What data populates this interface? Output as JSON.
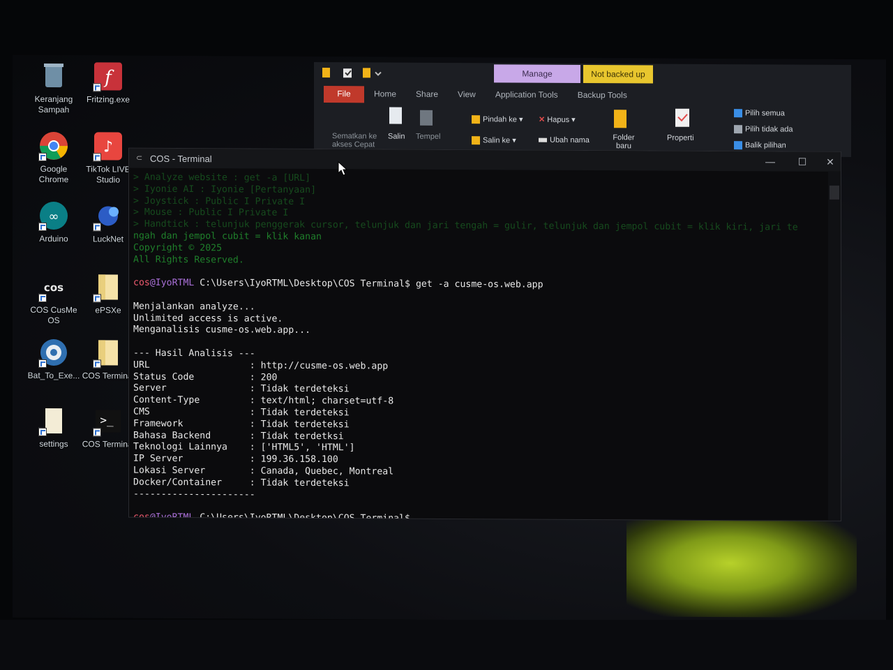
{
  "desktop": {
    "icons": [
      {
        "label": "Keranjang Sampah",
        "icon": "recycle-bin-icon"
      },
      {
        "label": "Fritzing.exe",
        "icon": "fritzing-icon"
      },
      {
        "label": "Google Chrome",
        "icon": "chrome-icon"
      },
      {
        "label": "TikTok LIVE Studio",
        "icon": "tiktok-live-icon"
      },
      {
        "label": "Arduino",
        "icon": "arduino-icon"
      },
      {
        "label": "LuckNet",
        "icon": "lucknet-icon"
      },
      {
        "label": "COS CusMe OS",
        "icon": "cos-icon"
      },
      {
        "label": "ePSXe",
        "icon": "folder-icon"
      },
      {
        "label": "Bat_To_Exe...",
        "icon": "gear-icon"
      },
      {
        "label": "COS Terminal",
        "icon": "folder-icon"
      },
      {
        "label": "settings",
        "icon": "file-icon"
      },
      {
        "label": "COS Terminal",
        "icon": "terminal-icon"
      }
    ]
  },
  "explorer": {
    "context_tabs": {
      "manage": "Manage",
      "backup": "Not backed up"
    },
    "tabs": [
      "File",
      "Home",
      "Share",
      "View",
      "Application Tools",
      "Backup Tools"
    ],
    "ribbon": {
      "pin": "Sematkan ke akses Cepat",
      "copy": "Salin",
      "paste": "Tempel",
      "move_to": "Pindah ke",
      "copy_to": "Salin ke",
      "delete": "Hapus",
      "rename": "Ubah nama",
      "new_folder": "Folder baru",
      "properties": "Properti",
      "select_all": "Pilih semua",
      "select_none": "Pilih tidak ada",
      "invert": "Balik pilihan"
    }
  },
  "terminal": {
    "title": "COS - Terminal",
    "faded_lines": [
      "> Analyze website : get -a [URL]",
      "> Iyonie AI : Iyonie [Pertanyaan]",
      "> Joystick : Public I Private I",
      "> Mouse : Public I Private I",
      "> Handtick : telunjuk penggerak cursor, telunjuk dan jari tengah = gulir, telunjuk dan jempol cubit = klik kiri, jari te",
      "ngah dan jempol cubit = klik kanan",
      "Copyright © 2025",
      "All Rights Reserved."
    ],
    "prompt_user": "cos",
    "prompt_host": "@IyoRTML",
    "prompt_path": " C:\\Users\\IyoRTML\\Desktop\\COS Terminal$",
    "command": " get -a cusme-os.web.app",
    "status_lines": [
      "Menjalankan analyze...",
      "Unlimited access is active.",
      "Menganalisis cusme-os.web.app..."
    ],
    "result_header": "--- Hasil Analisis ---",
    "results": [
      {
        "key": "URL              ",
        "value": "http://cusme-os.web.app"
      },
      {
        "key": "Status Code      ",
        "value": "200"
      },
      {
        "key": "Server           ",
        "value": "Tidak terdeteksi"
      },
      {
        "key": "Content-Type     ",
        "value": "text/html; charset=utf-8"
      },
      {
        "key": "CMS              ",
        "value": "Tidak terdeteksi"
      },
      {
        "key": "Framework        ",
        "value": "Tidak terdeteksi"
      },
      {
        "key": "Bahasa Backend   ",
        "value": "Tidak terdetksi"
      },
      {
        "key": "Teknologi Lainnya",
        "value": "['HTML5', 'HTML']"
      },
      {
        "key": "IP Server        ",
        "value": "199.36.158.100"
      },
      {
        "key": "Lokasi Server    ",
        "value": "Canada, Quebec, Montreal"
      },
      {
        "key": "Docker/Container ",
        "value": "Tidak terdeteksi"
      }
    ],
    "separator": "----------------------"
  }
}
